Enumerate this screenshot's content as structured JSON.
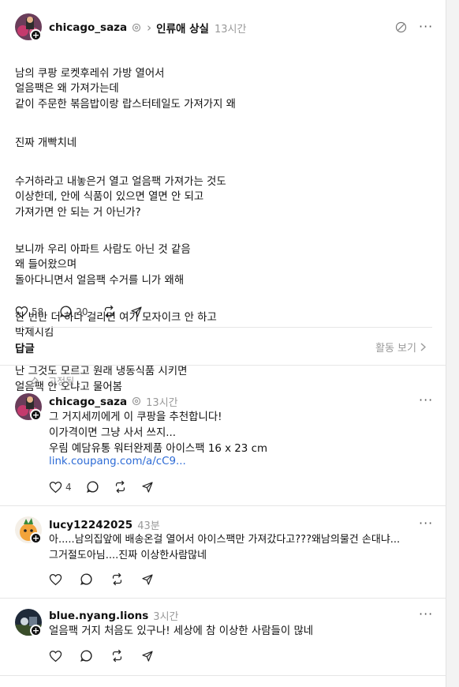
{
  "post": {
    "username": "chicago_saza",
    "breadcrumb_sep": "›",
    "topic": "인류애 상실",
    "time": "13시간",
    "paragraphs": [
      "남의 쿠팡 로켓후레쉬 가방 열어서\n얼음팩은 왜 가져가는데\n같이 주문한 볶음밥이랑 랍스터테일도 가져가지 왜",
      "진짜 개빡치네",
      "수거하라고 내놓은거 열고 얼음팩 가져가는 것도\n이상한데, 안에 식품이 있으면 열면 안 되고\n가져가면 안 되는 거 아닌가?",
      "보니까 우리 아파트 사람도 아닌 것 같음\n왜 들어왔으며\n돌아다니면서 얼음팩 수거를 니가 왜해",
      "한 번만 더 하다 걸리면 여기 모자이크 안 하고\n박제시킴",
      "난 그것도 모르고 원래 냉동식품 시키면\n얼음팩 안 오냐고 물어봄"
    ],
    "likes": "58",
    "comments": "20"
  },
  "replies_header": {
    "title": "답글",
    "activity_link": "활동 보기"
  },
  "replies": [
    {
      "pinned_label": "고정됨",
      "username": "chicago_saza",
      "time": "13시간",
      "lines": "그 거지세끼에게 이 쿠팡을 추천합니다!\n이가격이면 그냥 사서 쓰지...\n우림 예담유통 워터완제품 아이스팩 16 x 23 cm",
      "link": "link.coupang.com/a/cC9...",
      "likes": "4"
    },
    {
      "username": "lucy12242025",
      "time": "43분",
      "lines": "아.....남의집앞에 배송온걸 열어서 아이스팩만 가져갔다고???왜남의물건 손대냐...\n그거절도아님....진짜 이상한사람많네"
    },
    {
      "username": "blue.nyang.lions",
      "time": "3시간",
      "lines": "얼음팩 거지 처음도 있구나! 세상에 참 이상한 사람들이 많네"
    }
  ],
  "icons": [
    "threads-icon",
    "more-icon",
    "heart-icon",
    "comment-icon",
    "repost-icon",
    "share-icon",
    "pin-icon",
    "chevron-right-icon"
  ]
}
